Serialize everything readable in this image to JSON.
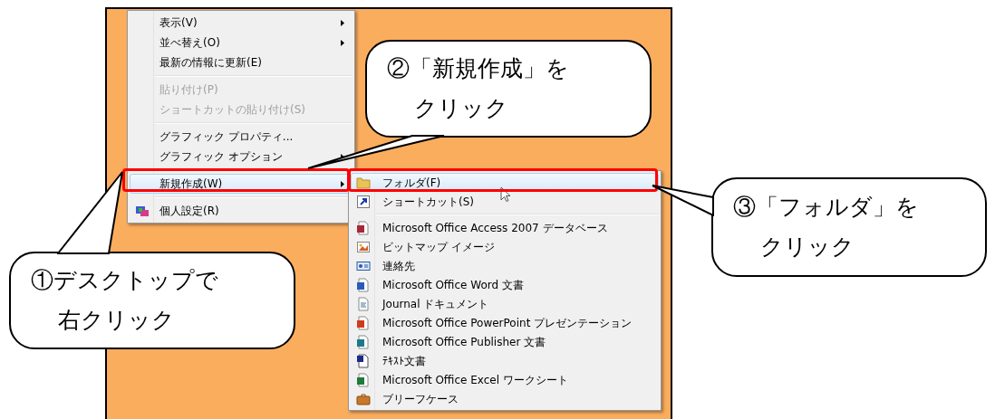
{
  "context_menu": {
    "items": [
      {
        "kind": "item",
        "label": "表示(V)",
        "disabled": false,
        "submenu": true,
        "selected": false
      },
      {
        "kind": "item",
        "label": "並べ替え(O)",
        "disabled": false,
        "submenu": true,
        "selected": false
      },
      {
        "kind": "item",
        "label": "最新の情報に更新(E)",
        "disabled": false,
        "submenu": false,
        "selected": false
      },
      {
        "kind": "separator"
      },
      {
        "kind": "item",
        "label": "貼り付け(P)",
        "disabled": true,
        "submenu": false,
        "selected": false
      },
      {
        "kind": "item",
        "label": "ショートカットの貼り付け(S)",
        "disabled": true,
        "submenu": false,
        "selected": false
      },
      {
        "kind": "separator"
      },
      {
        "kind": "item",
        "label": "グラフィック プロパティ...",
        "disabled": false,
        "submenu": false,
        "selected": false
      },
      {
        "kind": "item",
        "label": "グラフィック オプション",
        "disabled": false,
        "submenu": true,
        "selected": false
      },
      {
        "kind": "separator"
      },
      {
        "kind": "item",
        "label": "新規作成(W)",
        "disabled": false,
        "submenu": true,
        "selected": true
      },
      {
        "kind": "separator"
      },
      {
        "kind": "item",
        "label": "個人設定(R)",
        "disabled": false,
        "submenu": false,
        "selected": false
      }
    ]
  },
  "new_submenu": {
    "items": [
      {
        "kind": "item",
        "label": "フォルダ(F)",
        "selected": true
      },
      {
        "kind": "item",
        "label": "ショートカット(S)",
        "selected": false
      },
      {
        "kind": "separator"
      },
      {
        "kind": "item",
        "label": "Microsoft Office Access 2007 データベース",
        "selected": false
      },
      {
        "kind": "item",
        "label": "ビットマップ イメージ",
        "selected": false
      },
      {
        "kind": "item",
        "label": "連絡先",
        "selected": false
      },
      {
        "kind": "item",
        "label": "Microsoft Office Word 文書",
        "selected": false
      },
      {
        "kind": "item",
        "label": "Journal ドキュメント",
        "selected": false
      },
      {
        "kind": "item",
        "label": "Microsoft Office PowerPoint プレゼンテーション",
        "selected": false
      },
      {
        "kind": "item",
        "label": "Microsoft Office Publisher 文書",
        "selected": false
      },
      {
        "kind": "item",
        "label": "ﾃｷｽﾄ文書",
        "selected": false
      },
      {
        "kind": "item",
        "label": "Microsoft Office Excel ワークシート",
        "selected": false
      },
      {
        "kind": "item",
        "label": "ブリーフケース",
        "selected": false
      }
    ]
  },
  "callouts": [
    {
      "lines": [
        "①デスクトップで",
        "右クリック"
      ]
    },
    {
      "lines": [
        "②「新規作成」を",
        "クリック"
      ]
    },
    {
      "lines": [
        "③「フォルダ」を",
        "クリック"
      ]
    }
  ]
}
